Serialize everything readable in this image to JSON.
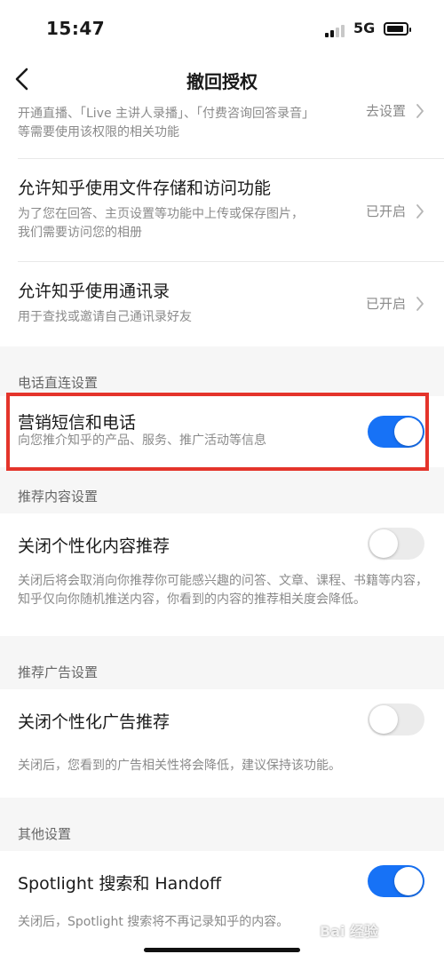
{
  "status_bar": {
    "time": "15:47",
    "network": "5G"
  },
  "nav": {
    "title": "撤回授权"
  },
  "permissions": [
    {
      "title": "",
      "desc": "开通直播、「Live 主讲人录播」、「付费咨询回答录音」等需要使用该权限的相关功能",
      "status": "去设置"
    },
    {
      "title": "允许知乎使用文件存储和访问功能",
      "desc": "为了您在回答、主页设置等功能中上传或保存图片，我们需要访问您的相册",
      "status": "已开启"
    },
    {
      "title": "允许知乎使用通讯录",
      "desc": "用于查找或邀请自己通讯录好友",
      "status": "已开启"
    }
  ],
  "phone_section": {
    "label": "电话直连设置",
    "item": {
      "title": "营销短信和电话",
      "desc": "向您推介知乎的产品、服务、推广活动等信息",
      "enabled": true
    }
  },
  "recommend_section": {
    "label": "推荐内容设置",
    "item": {
      "title": "关闭个性化内容推荐",
      "desc": "关闭后将会取消向你推荐你可能感兴趣的问答、文章、课程、书籍等内容，知乎仅向你随机推送内容，你看到的内容的推荐相关度会降低。",
      "enabled": false
    }
  },
  "ad_section": {
    "label": "推荐广告设置",
    "item": {
      "title": "关闭个性化广告推荐",
      "desc": "关闭后，您看到的广告相关性将会降低，建议保持该功能。",
      "enabled": false
    }
  },
  "other_section": {
    "label": "其他设置",
    "item": {
      "title": "Spotlight 搜索和 Handoff",
      "desc": "关闭后，Spotlight 搜索将不再记录知乎的内容。",
      "enabled": true
    }
  },
  "watermark": "Bai 经验",
  "colors": {
    "accent": "#1772f6",
    "highlight": "#e4342b"
  }
}
